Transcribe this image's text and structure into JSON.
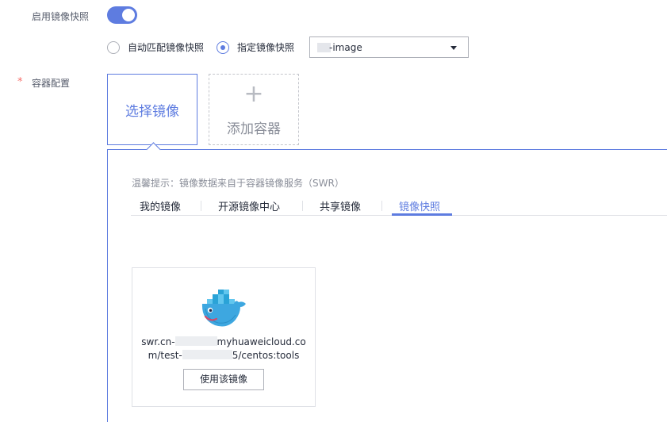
{
  "snapshot": {
    "enable_label": "启用镜像快照",
    "enabled": true,
    "radio_auto_label": "自动匹配镜像快照",
    "radio_specified_label": "指定镜像快照",
    "selected_image": "-image"
  },
  "container": {
    "label": "容器配置",
    "required_mark": "*",
    "select_image_card": "选择镜像",
    "add_container_plus": "+",
    "add_container_label": "添加容器"
  },
  "panel": {
    "hint": "温馨提示：镜像数据来自于容器镜像服务（SWR）",
    "tabs": [
      {
        "label": "我的镜像"
      },
      {
        "label": "开源镜像中心"
      },
      {
        "label": "共享镜像"
      },
      {
        "label": "镜像快照"
      }
    ],
    "active_tab": "镜像快照"
  },
  "image_card": {
    "icon": "docker-whale-icon",
    "line1_prefix": "swr.cn-",
    "line1_suffix": "myhuaweicloud.co",
    "line2_prefix": "m/test-",
    "line2_suffix": "5/centos:tools",
    "use_button": "使用该镜像"
  },
  "colors": {
    "accent": "#5e7ce0",
    "required": "#f66f6a",
    "border": "#dfe1e6"
  }
}
